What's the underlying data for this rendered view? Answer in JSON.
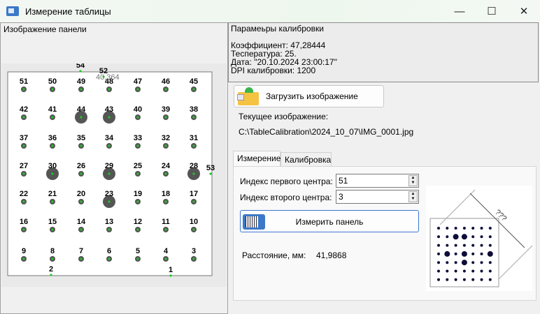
{
  "window": {
    "title": "Измерение таблицы",
    "minimize": "—",
    "maximize": "☐",
    "close": "✕"
  },
  "left_panel": {
    "label": "Изображение панели",
    "grid_labels": [
      [
        51,
        50,
        49,
        48,
        47,
        46,
        45
      ],
      [
        42,
        41,
        44,
        43,
        40,
        39,
        38
      ],
      [
        37,
        36,
        35,
        34,
        33,
        32,
        31
      ],
      [
        27,
        30,
        26,
        29,
        25,
        24,
        28
      ],
      [
        22,
        21,
        20,
        23,
        19,
        18,
        17
      ],
      [
        16,
        15,
        14,
        13,
        12,
        11,
        10
      ],
      [
        9,
        8,
        7,
        6,
        5,
        4,
        3
      ]
    ],
    "big_markers": [
      44,
      43,
      30,
      29,
      28,
      23
    ],
    "extra_points": [
      "54",
      "52",
      "53",
      "2",
      "1"
    ],
    "overlay_text": "40,364",
    "marker_color": "#22c822"
  },
  "calibration": {
    "title": "Парамеьры калибровки",
    "coefficient": "Коэффициент: 47,28444",
    "temperature": "Теспература:  25.",
    "date": "Дата:  \"20.10.2024 23:00:17\"",
    "dpi": "DPI калибровки:  1200"
  },
  "load_button": {
    "label": "Загрузить изображение",
    "icon": "folder-open-icon"
  },
  "current_image": {
    "label": "Текущее изображение:",
    "path": "C:\\TableCalibration\\2024_10_07\\IMG_0001.jpg"
  },
  "tabs": [
    {
      "label": "Измерение",
      "active": true
    },
    {
      "label": "Калибровка",
      "active": false
    }
  ],
  "measure": {
    "first_label": "Индекс первого центра:",
    "first_value": "51",
    "second_label": "Индекс второго центра:",
    "second_value": "3",
    "button": "Измерить панель",
    "distance_label": "Расстояние, мм:",
    "distance_value": "41,9868",
    "diagram_text": "???"
  }
}
